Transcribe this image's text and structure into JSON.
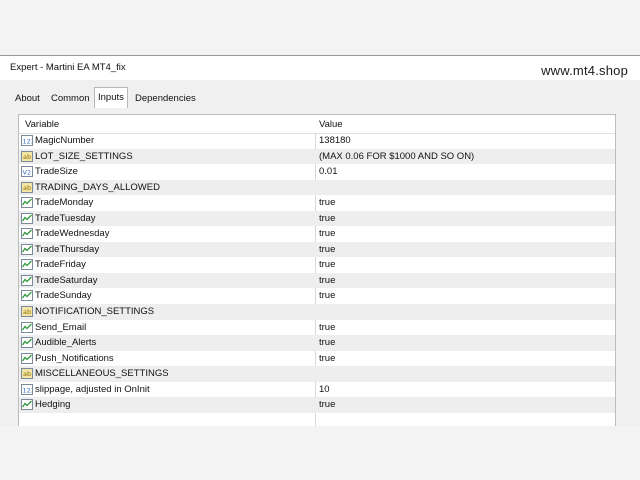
{
  "window": {
    "title": "Expert - Martini EA MT4_fix",
    "watermark": "www.mt4.shop"
  },
  "tabs": [
    {
      "label": "About",
      "active": false
    },
    {
      "label": "Common",
      "active": false
    },
    {
      "label": "Inputs",
      "active": true
    },
    {
      "label": "Dependencies",
      "active": false
    }
  ],
  "table": {
    "headers": {
      "variable": "Variable",
      "value": "Value"
    },
    "rows": [
      {
        "icon": "number-icon",
        "name": "MagicNumber",
        "value": "138180"
      },
      {
        "icon": "text-icon",
        "name": "LOT_SIZE_SETTINGS",
        "value": "(MAX 0.06 FOR $1000 AND SO ON)"
      },
      {
        "icon": "decimal-icon",
        "name": "TradeSize",
        "value": "0.01"
      },
      {
        "icon": "text-icon",
        "name": "TRADING_DAYS_ALLOWED",
        "value": ""
      },
      {
        "icon": "bool-icon",
        "name": "TradeMonday",
        "value": "true"
      },
      {
        "icon": "bool-icon",
        "name": "TradeTuesday",
        "value": "true"
      },
      {
        "icon": "bool-icon",
        "name": "TradeWednesday",
        "value": "true"
      },
      {
        "icon": "bool-icon",
        "name": "TradeThursday",
        "value": "true"
      },
      {
        "icon": "bool-icon",
        "name": "TradeFriday",
        "value": "true"
      },
      {
        "icon": "bool-icon",
        "name": "TradeSaturday",
        "value": "true"
      },
      {
        "icon": "bool-icon",
        "name": "TradeSunday",
        "value": "true"
      },
      {
        "icon": "text-icon",
        "name": "NOTIFICATION_SETTINGS",
        "value": ""
      },
      {
        "icon": "bool-icon",
        "name": "Send_Email",
        "value": "true"
      },
      {
        "icon": "bool-icon",
        "name": "Audible_Alerts",
        "value": "true"
      },
      {
        "icon": "bool-icon",
        "name": "Push_Notifications",
        "value": "true"
      },
      {
        "icon": "text-icon",
        "name": "MISCELLANEOUS_SETTINGS",
        "value": ""
      },
      {
        "icon": "number-icon",
        "name": "slippage, adjusted in OnInit",
        "value": "10"
      },
      {
        "icon": "bool-icon",
        "name": "Hedging",
        "value": "true"
      }
    ]
  },
  "colors": {
    "row_shade": "#eeeeee",
    "bool_icon": "#2e9a3a",
    "number_icon": "#3a6fc4",
    "text_icon": "#c9a227"
  }
}
